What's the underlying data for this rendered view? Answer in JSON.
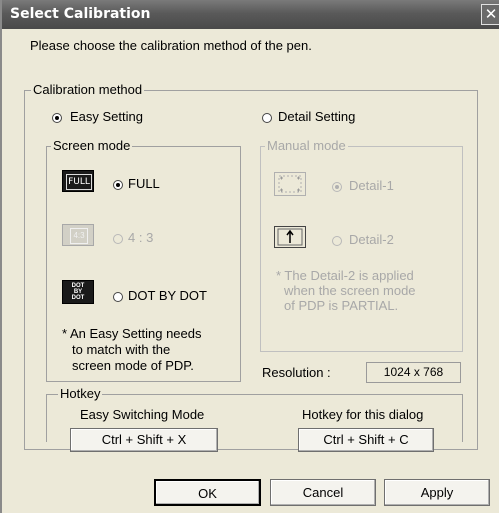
{
  "window": {
    "title": "Select Calibration",
    "close_glyph": "✕",
    "instruction": "Please choose the calibration method of the pen."
  },
  "calibration_method": {
    "label": "Calibration method",
    "easy": {
      "label": "Easy Setting",
      "selected": true
    },
    "detail": {
      "label": "Detail Setting",
      "selected": false
    }
  },
  "screen_mode": {
    "label": "Screen mode",
    "options": [
      {
        "icon_text": "FULL",
        "label": "FULL",
        "selected": true,
        "enabled": true
      },
      {
        "icon_text": "4:3",
        "label": "4 : 3",
        "selected": false,
        "enabled": false
      },
      {
        "icon_text": "DOT BY DOT",
        "label": "DOT BY DOT",
        "selected": false,
        "enabled": true
      }
    ],
    "note_lines": [
      "* An Easy Setting needs",
      "to match with the",
      "screen mode of PDP."
    ]
  },
  "manual_mode": {
    "label": "Manual mode",
    "options": [
      {
        "label": "Detail-1",
        "selected": true,
        "enabled": false
      },
      {
        "label": "Detail-2",
        "selected": false,
        "enabled": false
      }
    ],
    "note_lines": [
      "* The Detail-2 is applied",
      "when the screen mode",
      "of PDP is PARTIAL."
    ]
  },
  "resolution": {
    "label": "Resolution :",
    "value": "1024 x 768"
  },
  "hotkey": {
    "label": "Hotkey",
    "easy_label": "Easy Switching Mode",
    "easy_key": "Ctrl + Shift + X",
    "dialog_label": "Hotkey for this dialog",
    "dialog_key": "Ctrl + Shift + C"
  },
  "buttons": {
    "ok": "OK",
    "cancel": "Cancel",
    "apply": "Apply"
  },
  "colors": {
    "titlebar": "#5a5a5a",
    "dialog_bg": "#ece9d8",
    "disabled_text": "#a8a8a8"
  }
}
